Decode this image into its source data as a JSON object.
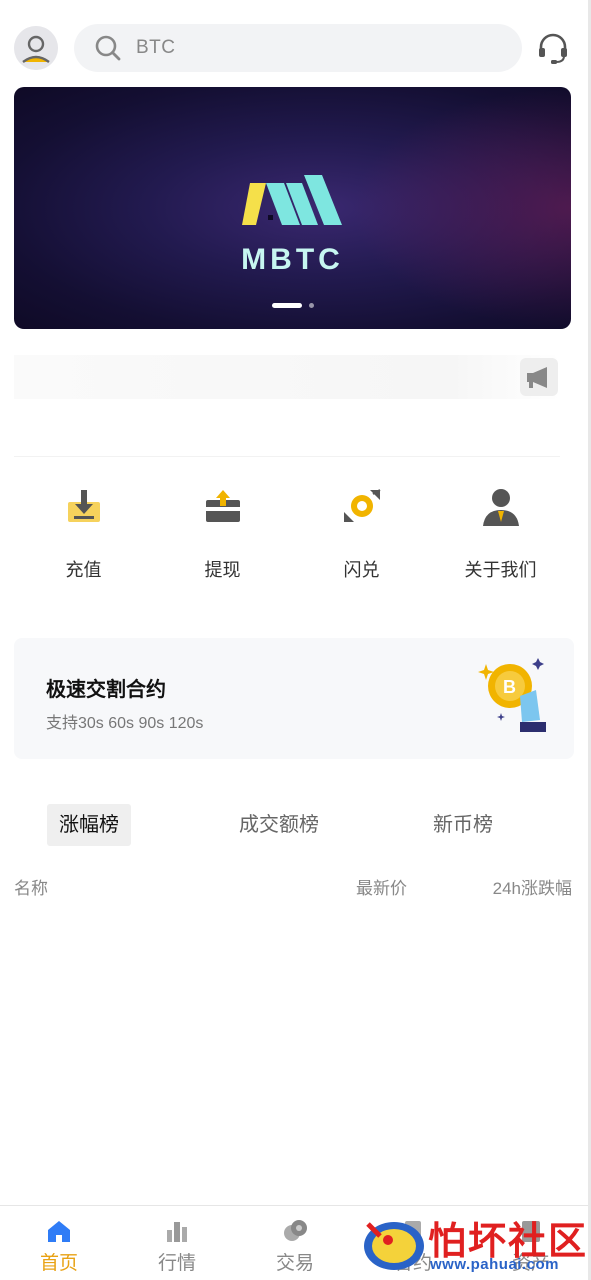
{
  "search": {
    "placeholder": "BTC"
  },
  "banner": {
    "logo_text": "MBTC",
    "slides": 2,
    "active_slide": 1
  },
  "actions": [
    {
      "label": "充值",
      "icon": "deposit-icon"
    },
    {
      "label": "提现",
      "icon": "withdraw-icon"
    },
    {
      "label": "闪兑",
      "icon": "flash-swap-icon"
    },
    {
      "label": "关于我们",
      "icon": "about-us-icon"
    }
  ],
  "promo": {
    "title": "极速交割合约",
    "subtitle": "支持30s 60s 90s 120s"
  },
  "ranking": {
    "tabs": [
      "涨幅榜",
      "成交额榜",
      "新币榜"
    ],
    "active_tab": 0,
    "columns": {
      "name": "名称",
      "price": "最新价",
      "change": "24h涨跌幅"
    }
  },
  "nav": [
    {
      "label": "首页",
      "icon": "home-icon",
      "active": true
    },
    {
      "label": "行情",
      "icon": "market-icon",
      "active": false
    },
    {
      "label": "交易",
      "icon": "trade-icon",
      "active": false
    },
    {
      "label": "合约",
      "icon": "contract-icon",
      "active": false
    },
    {
      "label": "资产",
      "icon": "assets-icon",
      "active": false
    }
  ],
  "watermark": {
    "text": "怕坏社区",
    "url": "www.pahuai.com"
  },
  "colors": {
    "accent": "#e8a214",
    "nav_blue": "#2f7cf6",
    "banner_bg": "#1d1545",
    "logo_cyan": "#7ee6e0",
    "logo_yellow": "#f5e04a"
  }
}
